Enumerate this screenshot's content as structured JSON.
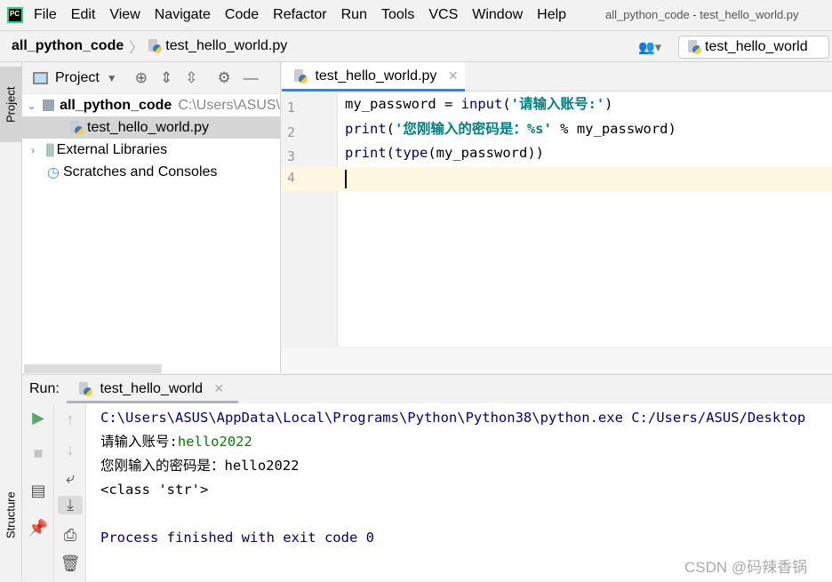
{
  "menubar": {
    "items": [
      "File",
      "Edit",
      "View",
      "Navigate",
      "Code",
      "Refactor",
      "Run",
      "Tools",
      "VCS",
      "Window",
      "Help"
    ],
    "window_title": "all_python_code - test_hello_world.py"
  },
  "navbar": {
    "project": "all_python_code",
    "file": "test_hello_world.py",
    "run_config": "test_hello_world"
  },
  "stripe": {
    "project_tab": "Project",
    "structure_tab": "Structure"
  },
  "project_panel": {
    "title": "Project",
    "tree": [
      {
        "label": "all_python_code",
        "path": "C:\\Users\\ASUS\\"
      },
      {
        "label": "test_hello_world.py"
      },
      {
        "label": "External Libraries"
      },
      {
        "label": "Scratches and Consoles"
      }
    ]
  },
  "editor": {
    "tab": "test_hello_world.py",
    "line_numbers": [
      "1",
      "2",
      "3",
      "4"
    ],
    "lines": [
      [
        {
          "t": "my_password = "
        },
        {
          "t": "input",
          "c": "fn"
        },
        {
          "t": "("
        },
        {
          "t": "'请输入账号:'",
          "c": "str"
        },
        {
          "t": ")"
        }
      ],
      [
        {
          "t": "print",
          "c": "fn"
        },
        {
          "t": "("
        },
        {
          "t": "'您刚输入的密码是：%s'",
          "c": "str"
        },
        {
          "t": " % my_password)"
        }
      ],
      [
        {
          "t": "print",
          "c": "fn"
        },
        {
          "t": "("
        },
        {
          "t": "type",
          "c": "fn"
        },
        {
          "t": "(my_password))"
        }
      ],
      []
    ]
  },
  "run": {
    "label": "Run:",
    "tab": "test_hello_world",
    "console": [
      {
        "text": "C:\\Users\\ASUS\\AppData\\Local\\Programs\\Python\\Python38\\python.exe C:/Users/ASUS/Desktop",
        "c": "cmd"
      },
      {
        "prompt": "请输入账号:",
        "input": "hello2022"
      },
      {
        "text": "您刚输入的密码是：hello2022"
      },
      {
        "text": "<class 'str'>"
      },
      {
        "text": "Process finished with exit code 0",
        "c": "fin"
      }
    ]
  },
  "watermark": "CSDN @码辣香锅",
  "colors": {
    "accent": "#4083c9",
    "keyword": "#000080",
    "string": "#008080",
    "user_input": "#008000",
    "current_line": "#fef8e2",
    "run_green": "#59a869"
  }
}
